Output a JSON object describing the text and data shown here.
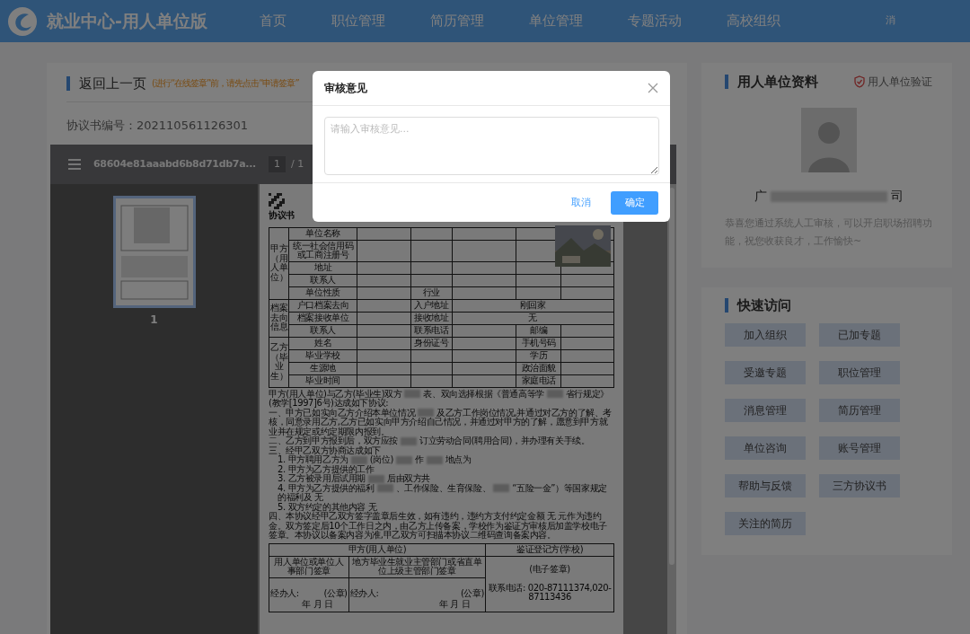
{
  "header": {
    "logo_text": "就业中心-用人单位版",
    "nav": [
      {
        "label": "首页"
      },
      {
        "label": "职位管理"
      },
      {
        "label": "简历管理"
      },
      {
        "label": "单位管理"
      },
      {
        "label": "专题活动"
      },
      {
        "label": "高校组织"
      }
    ],
    "user_text": "消"
  },
  "main": {
    "back_link": "返回上一页",
    "notice": "(进行“在线签章”前，请先点击“申请签章”",
    "agreement_no": "协议书编号：202110561126301",
    "viewer": {
      "file_name": "68604e81aaabd6b8d71db7a...",
      "page_input": "1",
      "page_total": "/ 1",
      "thumbnails": [
        {
          "label": "1",
          "selected": true
        }
      ],
      "document": {
        "heading": "协议书",
        "groups": [
          {
            "title": "甲方（用人单位）",
            "rows": [
              {
                "label": "单位名称"
              },
              {
                "label": "统一社会信用码或工商注册号"
              },
              {
                "label": "地址"
              },
              {
                "label": "联系人"
              },
              {
                "label": "单位性质",
                "label2": "行业"
              }
            ]
          },
          {
            "title": "档案去向信息",
            "rows": [
              {
                "label": "户口档案去向",
                "label2": "入户地址",
                "value2": "刚回家"
              },
              {
                "label": "档案接收单位",
                "label2": "接收地址",
                "value2": "无"
              },
              {
                "label": "联系人",
                "label2": "联系电话",
                "label3": "邮编"
              }
            ]
          },
          {
            "title": "乙方（毕业生）",
            "rows": [
              {
                "label": "姓名",
                "label2": "身份证号",
                "label3": "手机号码"
              },
              {
                "label": "毕业学校",
                "label3": "学历"
              },
              {
                "label": "生源地",
                "label3": "政治面貌"
              },
              {
                "label": "毕业时间",
                "label3": "家庭电话"
              }
            ]
          }
        ],
        "paragraphs": [
          {
            "parts": [
              "甲方(用人单位)与乙方(毕业生)双方",
              "表、双向选择根据《普通高等学",
              "省行规定》(教学[1997]6号)达成如下协议:"
            ]
          },
          {
            "parts": [
              "一、甲方已如实向乙方介绍本单位情况",
              "及乙方工作岗位情况,并通过对乙方的了解、考核，同意录用乙方,乙方已如实向甲方介绍自己情况，并通过对甲方的了解，愿意到甲方就业并在规定或约定期限内报到。"
            ]
          },
          {
            "parts": [
              "二、乙方到甲方报到后，双方应按",
              "订立劳动合同(聘用合同)，并办理有关手续。"
            ]
          },
          {
            "parts": [
              "三、经甲乙双方协商达成如下"
            ]
          },
          {
            "parts": [
              "1. 甲方聘用乙方为",
              "(岗位)",
              "作",
              "地点为"
            ]
          },
          {
            "parts": [
              "2. 甲方为乙方提供的工作"
            ]
          },
          {
            "parts": [
              "3. 乙方被录用后试用期",
              "后由双方共"
            ]
          },
          {
            "parts": [
              "4. 甲方为乙方提供的福利",
              "、工作保险、生育保险、",
              "“五险一金”）等国家规定的福利及 无"
            ]
          },
          {
            "parts": [
              "5. 双方约定的其他内容 无"
            ]
          },
          {
            "parts": [
              "四、本协议经甲乙双方签字盖章后生效，如有违约，违约方支付约定金额 无 元作为违约金。双方签定后10个工作日之内，由乙方上传备案，学校作为鉴证方审核后加盖学校电子签章。本协议以备案内容为准,甲乙双方可扫描本协议二维码查询备案内容。"
            ]
          }
        ],
        "signature": {
          "party_a": "甲方(用人单位)",
          "verifier": "鉴证登记方(学校)",
          "unit_seal": "用人单位或单位人事部门签章",
          "dept_seal": "地方毕业生就业主管部门或省直单位上级主管部门签章",
          "e_seal": "(电子签章)",
          "contact": "联系电话: 020-87111374,020-87113436",
          "handler_a": "经办人:",
          "stamp_a": "(公章)",
          "date_a": "年 月 日",
          "handler_b": "经办人:",
          "stamp_b": "(公章)",
          "date_b": "年 月 日"
        }
      }
    }
  },
  "profile": {
    "title": "用人单位资料",
    "verify": "用人单位验证",
    "company_start": "广",
    "company_end": "司",
    "message": "恭喜您通过系统人工审核，可以开启职场招聘功能，祝您收获良才，工作愉快~"
  },
  "quick_access": {
    "title": "快速访问",
    "links": [
      {
        "label": "加入组织"
      },
      {
        "label": "已加专题"
      },
      {
        "label": "受邀专题"
      },
      {
        "label": "职位管理"
      },
      {
        "label": "消息管理"
      },
      {
        "label": "简历管理"
      },
      {
        "label": "单位咨询"
      },
      {
        "label": "账号管理"
      },
      {
        "label": "帮助与反馈"
      },
      {
        "label": "三方协议书"
      },
      {
        "label": "关注的简历"
      }
    ]
  },
  "modal": {
    "title": "审核意见",
    "placeholder": "请输入审核意见...",
    "cancel": "取消",
    "confirm": "确定"
  }
}
